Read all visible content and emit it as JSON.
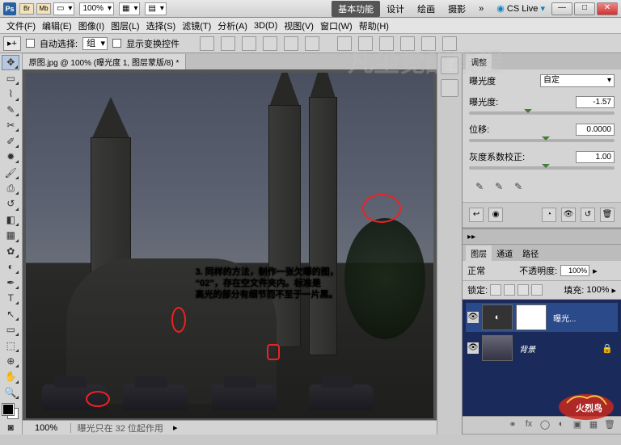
{
  "app": {
    "name": "Ps",
    "launchers": [
      "Br",
      "Mb"
    ],
    "view_pct": "100%"
  },
  "workspaces": [
    "基本功能",
    "设计",
    "绘画",
    "摄影"
  ],
  "cslive": "CS Live",
  "menus": [
    "文件(F)",
    "编辑(E)",
    "图像(I)",
    "图层(L)",
    "选择(S)",
    "滤镜(T)",
    "分析(A)",
    "3D(D)",
    "视图(V)",
    "窗口(W)",
    "帮助(H)"
  ],
  "options": {
    "auto_select": "自动选择:",
    "group": "组",
    "show_transform": "显示变换控件"
  },
  "doc_tab": "原图.jpg @ 100% (曝光度 1, 图层蒙版/8) *",
  "annotation": {
    "l1": "3. 同样的方法，制作一张欠曝的图，",
    "l2": "“02”，存在空文件夹内。标准是",
    "l3": "高光的部分有细节而不至于一片黑。"
  },
  "status": {
    "zoom": "100%",
    "info": "曝光只在 32 位起作用"
  },
  "panels": {
    "adjust_tab": "调整",
    "exposure": {
      "title": "曝光度",
      "preset": "自定",
      "exposure_lbl": "曝光度:",
      "exposure_val": "-1.57",
      "offset_lbl": "位移:",
      "offset_val": "0.0000",
      "gamma_lbl": "灰度系数校正:",
      "gamma_val": "1.00"
    },
    "layers": {
      "tabs": [
        "图层",
        "通道",
        "路径"
      ],
      "mode": "正常",
      "opacity_lbl": "不透明度:",
      "opacity_val": "100%",
      "lock_lbl": "锁定:",
      "fill_lbl": "填充:",
      "fill_val": "100%",
      "items": [
        {
          "name": "曝光..."
        },
        {
          "name": "背景"
        }
      ]
    }
  },
  "watermark": "凡尘觉醒教程"
}
